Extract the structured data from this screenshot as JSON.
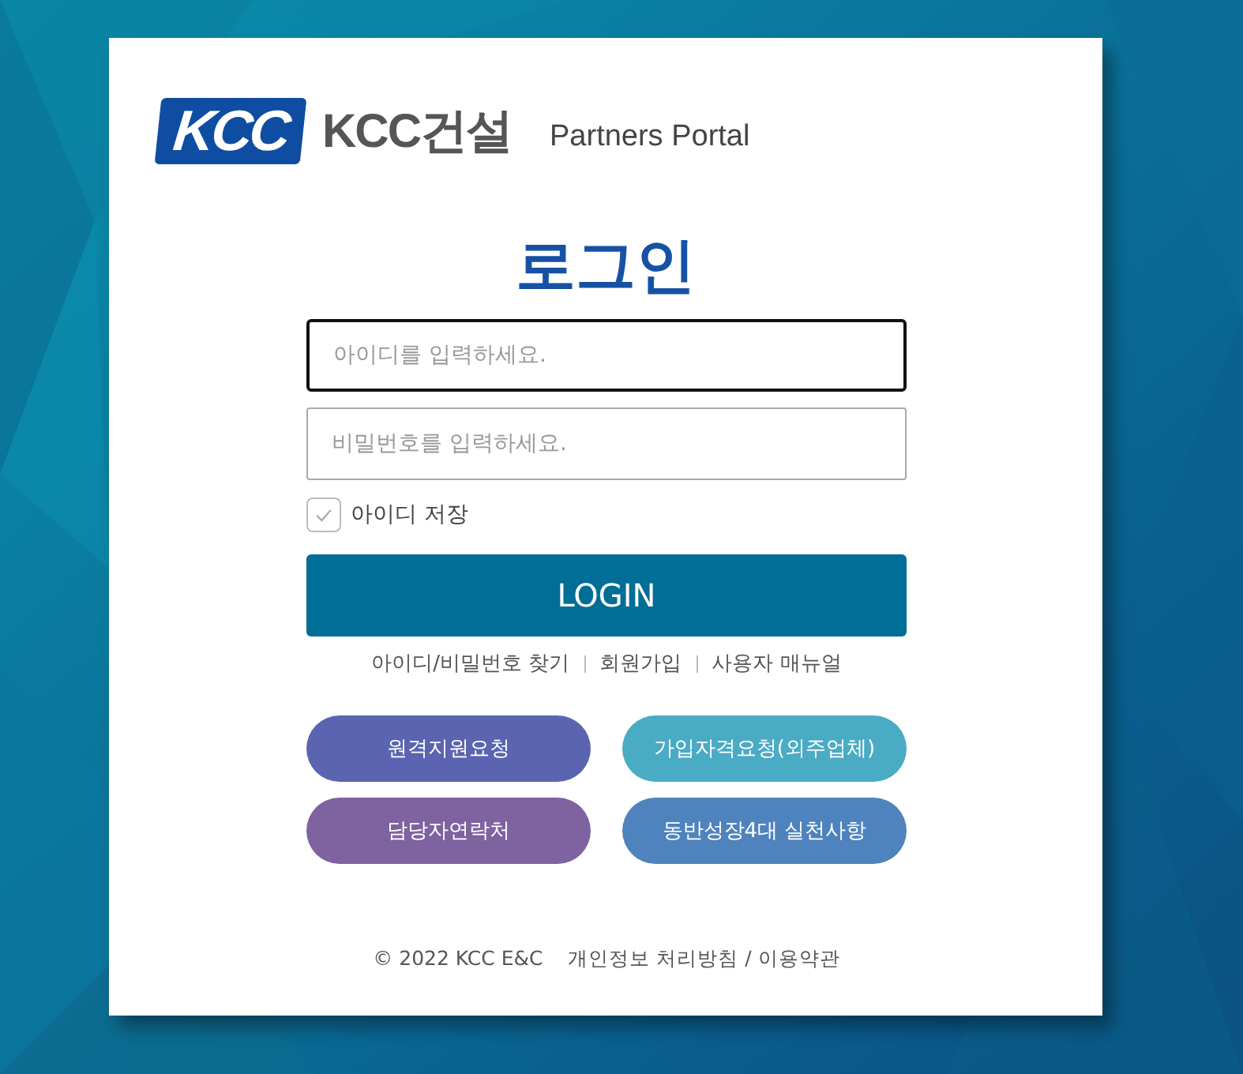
{
  "logo": {
    "badge": "KCC",
    "wordmark": "KCC건설",
    "subtitle": "Partners Portal"
  },
  "title": "로그인",
  "fields": [
    {
      "placeholder": "아이디를 입력하세요.",
      "focused": true
    },
    {
      "placeholder": "비밀번호를 입력하세요.",
      "focused": false
    }
  ],
  "remember": {
    "label": "아이디 저장",
    "checked": true
  },
  "login_button": "LOGIN",
  "links": [
    "아이디/비밀번호 찾기",
    "회원가입",
    "사용자 매뉴얼"
  ],
  "actions": [
    {
      "label": "원격지원요청",
      "color": "#5a64b0"
    },
    {
      "label": "가입자격요청(외주업체)",
      "color": "#4aabc4"
    },
    {
      "label": "담당자연락처",
      "color": "#7f62a0"
    },
    {
      "label": "동반성장4대 실천사항",
      "color": "#4f83bd"
    }
  ],
  "footer": {
    "copyright": "© 2022 KCC E&C",
    "policy": "개인정보 처리방침 / 이용약관"
  }
}
